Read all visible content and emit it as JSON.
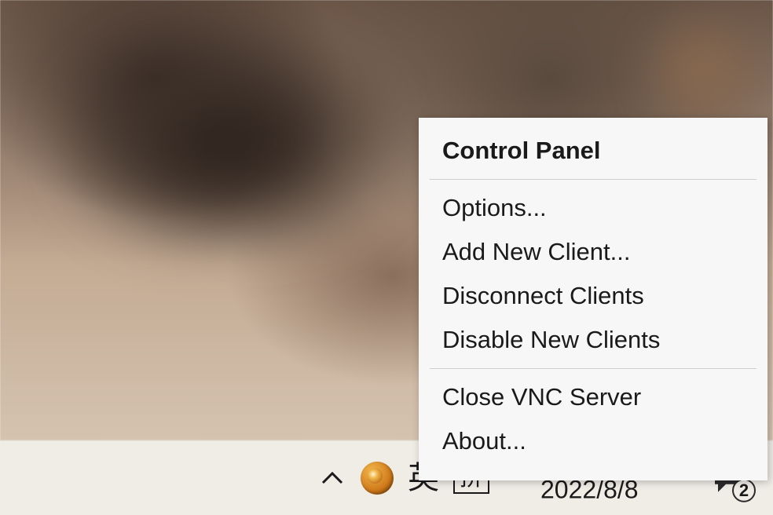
{
  "context_menu": {
    "default_item": "Control Panel",
    "items_group1": [
      "Options...",
      "Add New Client...",
      "Disconnect Clients",
      "Disable New Clients"
    ],
    "items_group2": [
      "Close VNC Server",
      "About..."
    ]
  },
  "taskbar": {
    "ime_lang": "英",
    "ime_mode": "拼",
    "date": "2022/8/8",
    "notification_count": "2"
  }
}
